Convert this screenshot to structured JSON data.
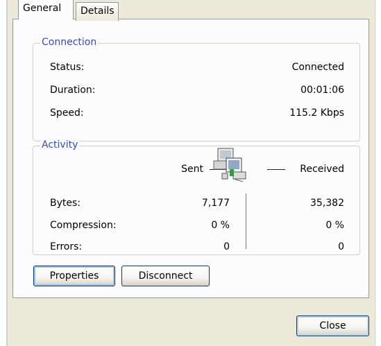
{
  "tabs": {
    "general": "General",
    "details": "Details"
  },
  "connection": {
    "title": "Connection",
    "status_label": "Status:",
    "status_value": "Connected",
    "duration_label": "Duration:",
    "duration_value": "00:01:06",
    "speed_label": "Speed:",
    "speed_value": "115.2 Kbps"
  },
  "activity": {
    "title": "Activity",
    "sent_label": "Sent",
    "received_label": "Received",
    "icon": "network-computers-icon",
    "rows": [
      {
        "label": "Bytes:",
        "sent": "7,177",
        "received": "35,382"
      },
      {
        "label": "Compression:",
        "sent": "0 %",
        "received": "0 %"
      },
      {
        "label": "Errors:",
        "sent": "0",
        "received": "0"
      }
    ]
  },
  "buttons": {
    "properties": "Properties",
    "disconnect": "Disconnect",
    "close": "Close"
  },
  "colors": {
    "group_title": "#2d4fb9",
    "dialog_bg": "#ece9d8",
    "button_border": "#003c74"
  }
}
